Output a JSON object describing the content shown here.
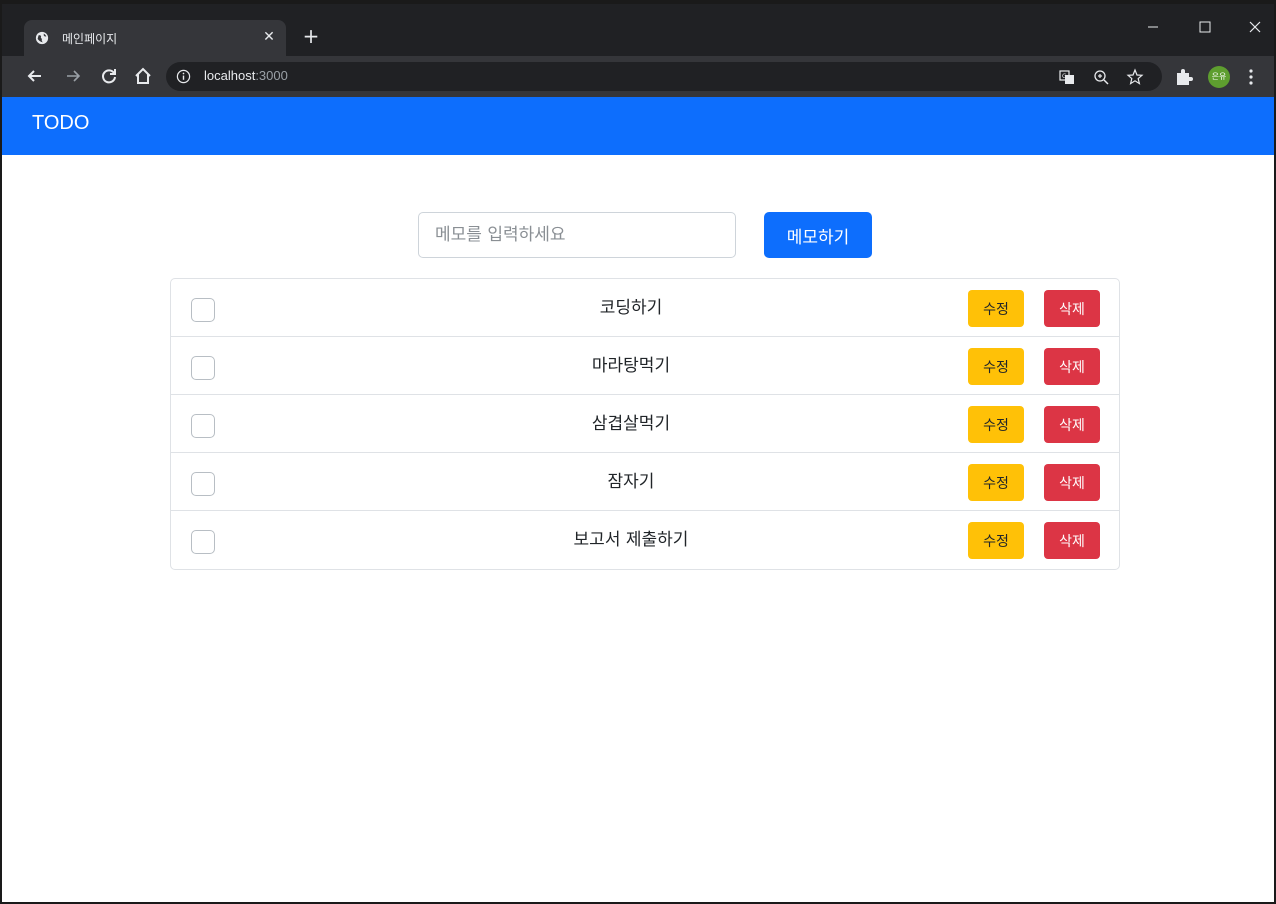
{
  "browser": {
    "tab_title": "메인페이지",
    "tab_favicon_icon": "globe-icon",
    "url_host": "localhost",
    "url_port": ":3000",
    "avatar_text": "은유",
    "avatar_color": "#5e9e2f"
  },
  "app": {
    "brand": "TODO",
    "brand_color": "#0d6efd"
  },
  "memo": {
    "placeholder": "메모를 입력하세요",
    "value": "",
    "submit_label": "메모하기"
  },
  "todos": [
    {
      "text": "코딩하기",
      "checked": false,
      "edit_label": "수정",
      "delete_label": "삭제"
    },
    {
      "text": "마라탕먹기",
      "checked": false,
      "edit_label": "수정",
      "delete_label": "삭제"
    },
    {
      "text": "삼겹살먹기",
      "checked": false,
      "edit_label": "수정",
      "delete_label": "삭제"
    },
    {
      "text": "잠자기",
      "checked": false,
      "edit_label": "수정",
      "delete_label": "삭제"
    },
    {
      "text": "보고서 제출하기",
      "checked": false,
      "edit_label": "수정",
      "delete_label": "삭제"
    }
  ],
  "colors": {
    "edit_button": "#ffc107",
    "delete_button": "#dc3545",
    "primary": "#0d6efd"
  }
}
